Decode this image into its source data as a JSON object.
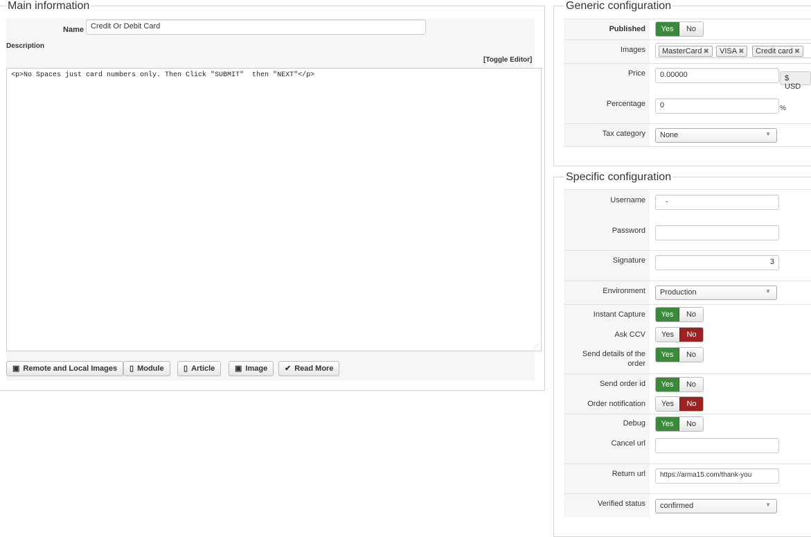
{
  "main": {
    "legend": "Main information",
    "name_label": "Name",
    "name_value": "Credit Or Debit Card",
    "description_label": "Description",
    "toggle_editor": "[Toggle Editor]",
    "description_value": "<p>No Spaces just card numbers only. Then Click \"SUBMIT\"  then \"NEXT\"</p>",
    "buttons": [
      {
        "label": "Remote and Local Images",
        "icon": "image-icon"
      },
      {
        "label": "Module",
        "icon": "file-add-icon"
      },
      {
        "label": "Article",
        "icon": "file-add-icon"
      },
      {
        "label": "Image",
        "icon": "image-icon"
      },
      {
        "label": "Read More",
        "icon": "chevron-down-icon"
      }
    ]
  },
  "generic": {
    "legend": "Generic configuration",
    "published_label": "Published",
    "images_label": "Images",
    "images": [
      "MasterCard",
      "VISA",
      "Credit card"
    ],
    "price_label": "Price",
    "price_value": "0.00000",
    "currency": "$ USD",
    "percentage_label": "Percentage",
    "percentage_value": "0",
    "percent_sign": "%",
    "tax_label": "Tax category",
    "tax_value": "None"
  },
  "specific": {
    "legend": "Specific configuration",
    "username_label": "Username",
    "username_value": "-",
    "password_label": "Password",
    "password_value": "",
    "signature_label": "Signature",
    "signature_value": "3",
    "environment_label": "Environment",
    "environment_value": "Production",
    "instant_capture_label": "Instant Capture",
    "ask_ccv_label": "Ask CCV",
    "send_details_label": "Send details of the order",
    "send_order_id_label": "Send order id",
    "order_notification_label": "Order notification",
    "debug_label": "Debug",
    "cancel_url_label": "Cancel url",
    "cancel_url_value": "",
    "return_url_label": "Return url",
    "return_url_value": "https://arma15.com/thank-you",
    "verified_status_label": "Verified status",
    "verified_status_value": "confirmed"
  },
  "toggle": {
    "yes": "Yes",
    "no": "No"
  },
  "colors": {
    "yes_active": "#3b8a3b",
    "no_active": "#9c2222",
    "border": "#d4d4d4"
  }
}
